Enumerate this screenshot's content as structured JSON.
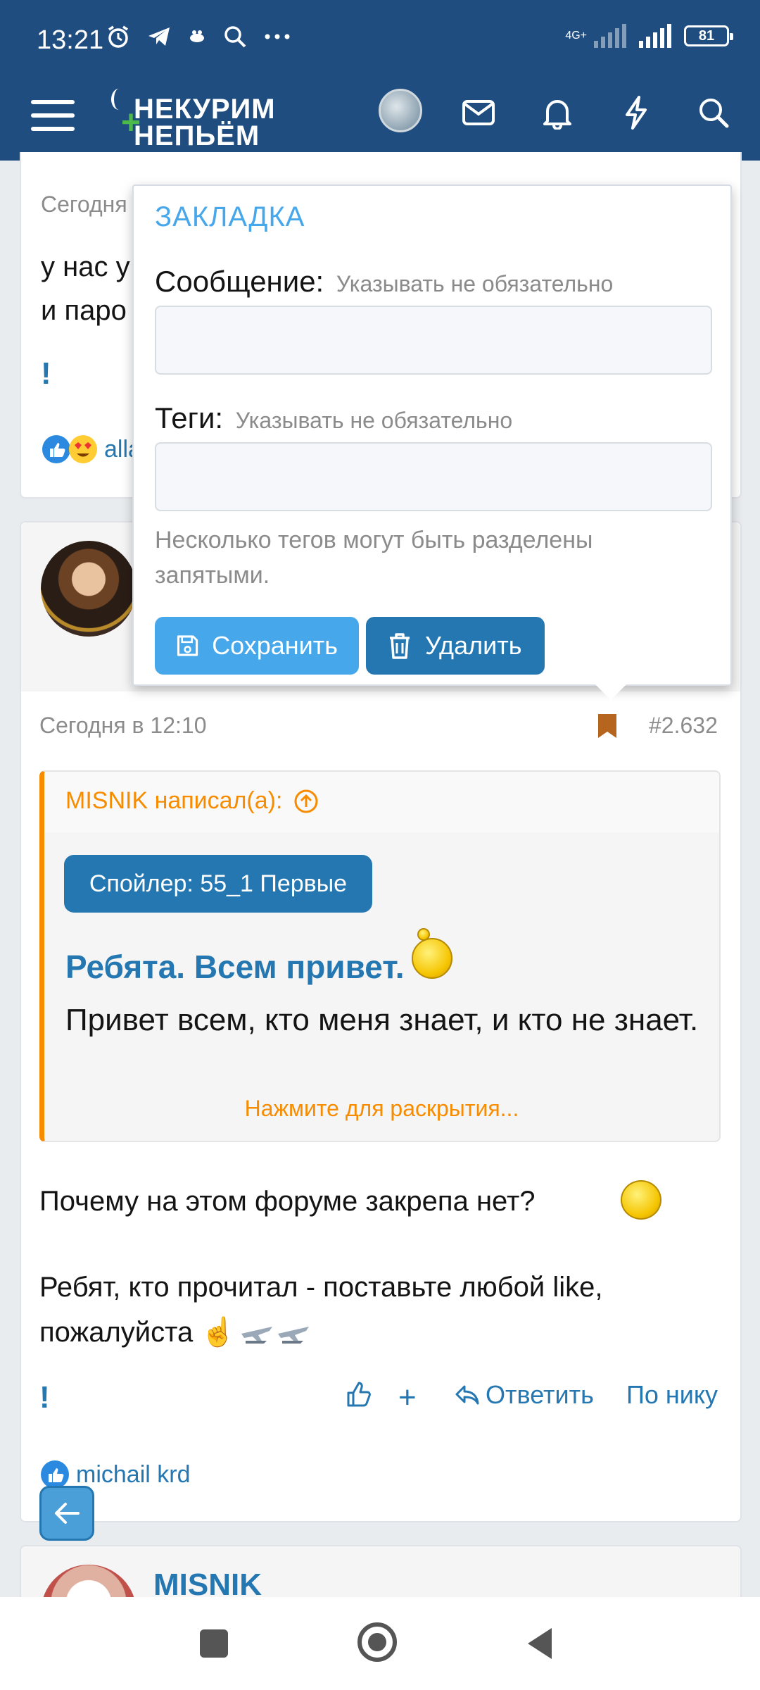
{
  "status_bar": {
    "time": "13:21",
    "network": "4G+",
    "battery": "81"
  },
  "header": {
    "logo_line1": "НЕКУРИМ",
    "logo_line2": "НЕПЬЁМ"
  },
  "post1": {
    "time_partial": "Сегодня",
    "text_line1": "у нас у",
    "text_line2": "и паро",
    "exclaim": "!",
    "reaction_user_partial": "alla"
  },
  "bookmark_popup": {
    "title": "ЗАКЛАДКА",
    "message_label": "Сообщение:",
    "message_hint": "Указывать не обязательно",
    "tags_label": "Теги:",
    "tags_hint": "Указывать не обязательно",
    "tags_note": "Несколько тегов могут быть разделены запятыми.",
    "save_label": "Сохранить",
    "delete_label": "Удалить"
  },
  "post2": {
    "time": "Сегодня в 12:10",
    "post_number": "#2.632",
    "quote": {
      "author_line": "MISNIK написал(а):",
      "spoiler_label": "Спойлер: 55_1 Первые",
      "heading": "Ребята. Всем привет.",
      "text": "Привет всем, кто меня знает, и кто не знает.",
      "expand_label": "Нажмите для раскрытия..."
    },
    "body_line1": "Почему на этом форуме закрепа нет?",
    "body_line2": "Ребят, кто прочитал - поставьте любой like,",
    "body_line3": "пожалуйста ☝️",
    "exclaim": "!",
    "plus_label": "+",
    "reply_label": "Ответить",
    "by_nick_label": "По нику",
    "reaction_user": "michail krd"
  },
  "post3": {
    "author": "MISNIK"
  },
  "colors": {
    "header_bg": "#1f4d80",
    "accent": "#2577b1",
    "accent_light": "#47a7eb",
    "quote_orange": "#f78c00",
    "bookmark_icon": "#b5651d"
  }
}
